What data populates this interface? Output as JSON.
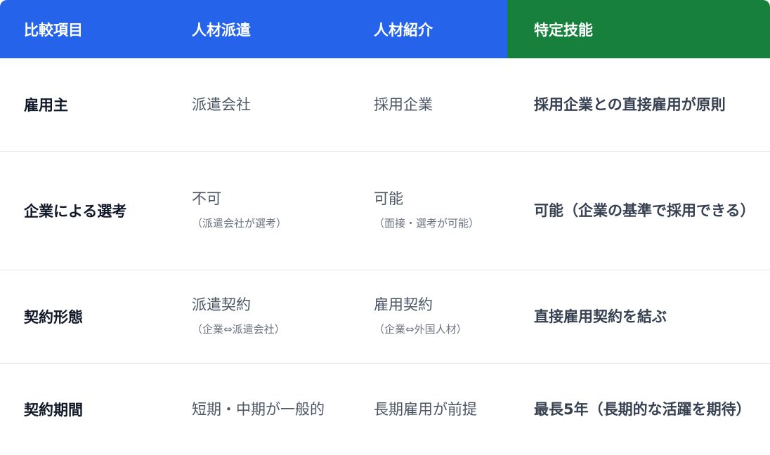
{
  "headers": {
    "item": "比較項目",
    "dispatch": "人材派遣",
    "placement": "人材紹介",
    "specified_skill": "特定技能"
  },
  "rows": [
    {
      "item": "雇用主",
      "dispatch": {
        "main": "派遣会社",
        "sub": ""
      },
      "placement": {
        "main": "採用企業",
        "sub": ""
      },
      "specified_skill": "採用企業との直接雇用が原則"
    },
    {
      "item": "企業による選考",
      "dispatch": {
        "main": "不可",
        "sub": "（派遣会社が選考）"
      },
      "placement": {
        "main": "可能",
        "sub": "（面接・選考が可能）"
      },
      "specified_skill": "可能（企業の基準で採用できる）"
    },
    {
      "item": "契約形態",
      "dispatch": {
        "main": "派遣契約",
        "sub": "（企業⇔派遣会社）"
      },
      "placement": {
        "main": "雇用契約",
        "sub": "（企業⇔外国人材）"
      },
      "specified_skill": "直接雇用契約を結ぶ"
    },
    {
      "item": "契約期間",
      "dispatch": {
        "main": "短期・中期が一般的",
        "sub": ""
      },
      "placement": {
        "main": "長期雇用が前提",
        "sub": ""
      },
      "specified_skill": "最長5年（長期的な活躍を期待）"
    }
  ],
  "colors": {
    "header_blue": "#2563eb",
    "header_green": "#16803c",
    "row_divider": "#e5e7eb"
  }
}
